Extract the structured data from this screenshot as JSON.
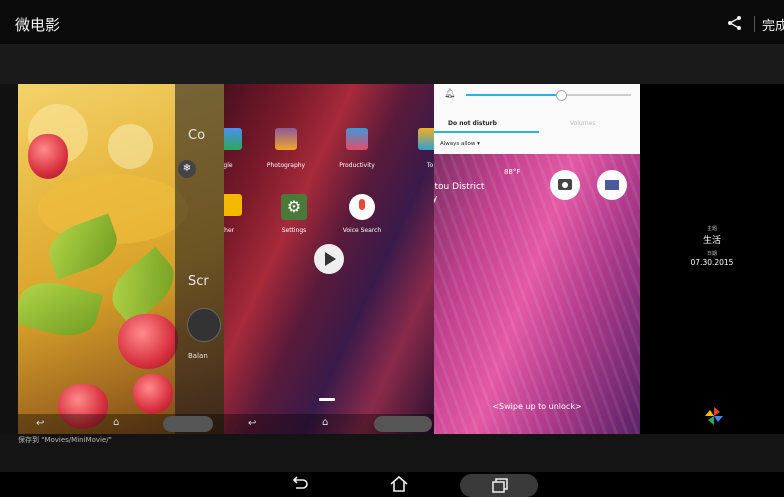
{
  "app": {
    "title": "微电影",
    "done_label": "完成"
  },
  "panels": {
    "settings_panel": {
      "col_text": "Co",
      "scr_text": "Scr",
      "bal_text": "Balan"
    },
    "launcher": {
      "apps": [
        {
          "label": "gle"
        },
        {
          "label": "Photography"
        },
        {
          "label": "Productivity"
        },
        {
          "label": "To"
        },
        {
          "label": "ther"
        },
        {
          "label": "Settings"
        },
        {
          "label": "Voice Search"
        }
      ]
    },
    "lockscreen": {
      "tab_dnd": "Do not disturb",
      "tab_volumes": "Volumes",
      "always_allow": "Always allow ▾",
      "location": "itou District",
      "location2": "y",
      "temperature": "88°F",
      "swipe_text": "<Swipe up to unlock>"
    },
    "title_card": {
      "theme_label": "主题",
      "theme_value": "生活",
      "date_label": "日期",
      "date_value": "07.30.2015"
    }
  },
  "status": {
    "save_path": "保存到 \"Movies/MiniMovie/\""
  },
  "icons": {
    "share": "share-icon",
    "back": "back-icon",
    "home": "home-icon",
    "recents": "recents-icon",
    "play": "play-icon",
    "camera": "camera-icon",
    "mail": "mail-icon",
    "pinwheel": "pinwheel-icon"
  },
  "colors": {
    "accent": "#27b3e0",
    "lock_pink": "#e35aa6"
  }
}
